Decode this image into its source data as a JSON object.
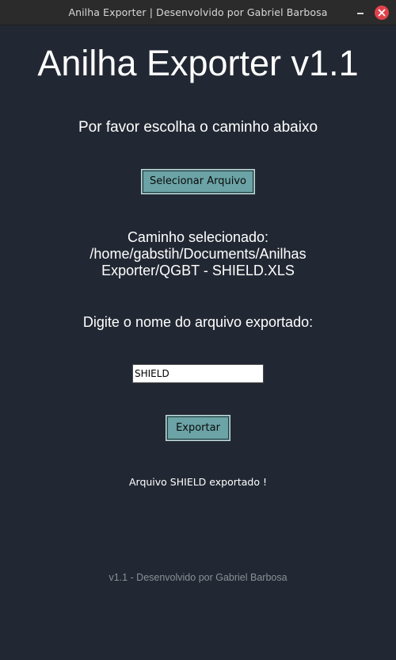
{
  "window": {
    "title": "Anilha Exporter | Desenvolvido por Gabriel Barbosa"
  },
  "app": {
    "title": "Anilha Exporter v1.1",
    "prompt": "Por favor escolha o caminho abaixo",
    "select_button_label": "Selecionar Arquivo",
    "selected_path_label": "Caminho selecionado:",
    "selected_path_line1": "/home/gabstih/Documents/Anilhas",
    "selected_path_line2": "Exporter/QGBT - SHIELD.XLS",
    "filename_prompt": "Digite o nome do arquivo exportado:",
    "filename_value": "SHIELD",
    "export_button_label": "Exportar",
    "status_message": "Arquivo SHIELD exportado !",
    "footer": "v1.1 - Desenvolvido por Gabriel Barbosa"
  },
  "colors": {
    "background": "#222833",
    "button": "#6ba3a6",
    "close": "#e0424b"
  },
  "icons": {
    "minimize": "minimize-icon",
    "close": "close-icon"
  }
}
